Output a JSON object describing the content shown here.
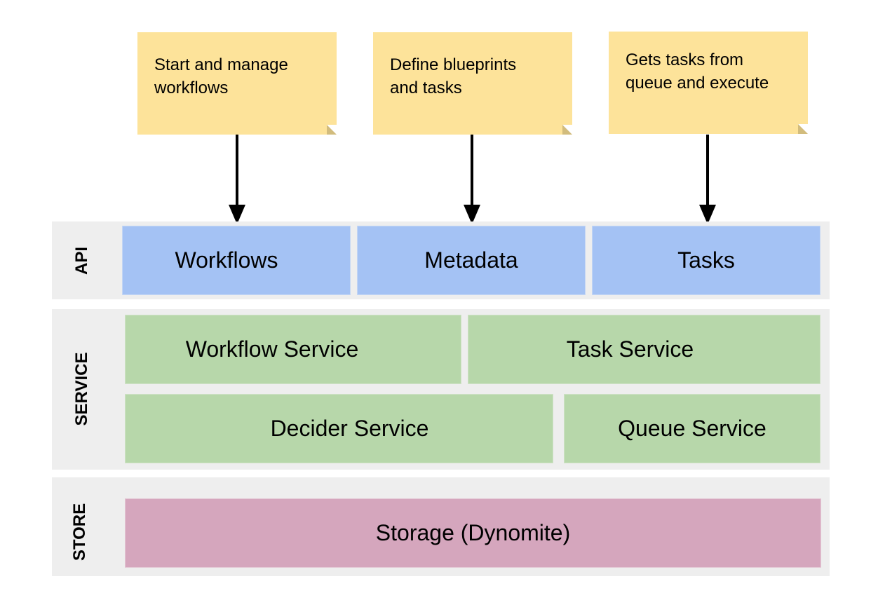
{
  "notes": [
    {
      "text_line1": "Start and manage",
      "text_line2": "workflows"
    },
    {
      "text_line1": "Define blueprints",
      "text_line2": "and tasks"
    },
    {
      "text_line1": "Gets tasks from",
      "text_line2": "queue and execute"
    }
  ],
  "layers": {
    "api": {
      "label": "API",
      "boxes": [
        "Workflows",
        "Metadata",
        "Tasks"
      ]
    },
    "service": {
      "label": "SERVICE",
      "boxes": [
        "Workflow Service",
        "Task Service",
        "Decider Service",
        "Queue Service"
      ]
    },
    "store": {
      "label": "STORE",
      "boxes": [
        "Storage (Dynomite)"
      ]
    }
  },
  "colors": {
    "note": "#fde39a",
    "api": "#a4c2f4",
    "service": "#b7d7aa",
    "store": "#d5a6bd",
    "band": "#eeeeee"
  }
}
